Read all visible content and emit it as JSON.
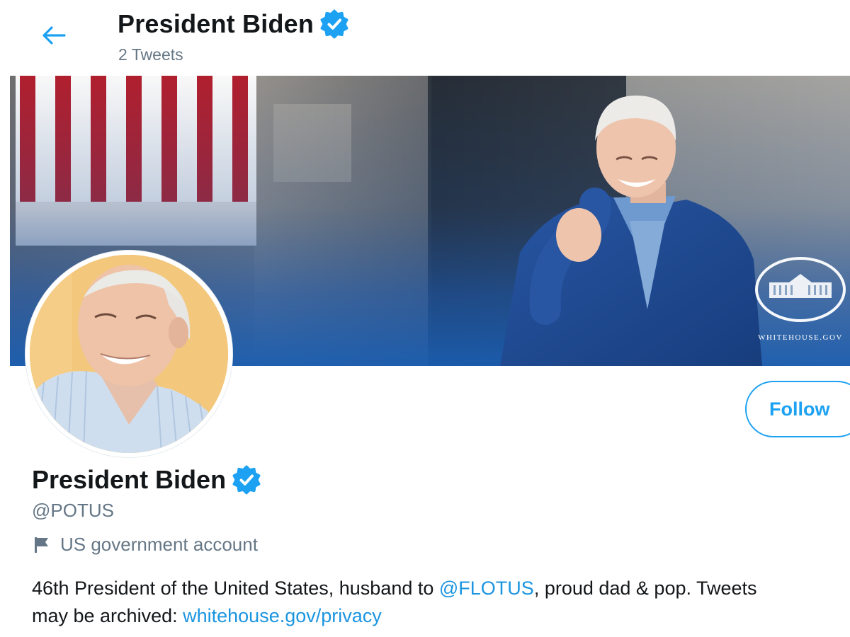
{
  "header": {
    "title": "President Biden",
    "tweet_count": "2 Tweets"
  },
  "banner": {
    "watermark": "WHITEHOUSE.GOV"
  },
  "profile": {
    "name": "President Biden",
    "handle": "@POTUS",
    "label": "US government account",
    "bio": {
      "line1_text": "46th President of the United States, husband to ",
      "line1_mention": "@FLOTUS",
      "line1_rest": ", proud dad & pop. Tweets",
      "line2_text": "may be archived: ",
      "line2_link": "whitehouse.gov/privacy"
    }
  },
  "actions": {
    "follow_label": "Follow"
  },
  "icons": {
    "back": "arrow-left-icon",
    "verified": "verified-badge-icon",
    "government": "flag-icon"
  },
  "colors": {
    "accent": "#1da1f2",
    "link": "#1b95e0",
    "secondary_text": "#657786",
    "primary_text": "#14171a"
  }
}
